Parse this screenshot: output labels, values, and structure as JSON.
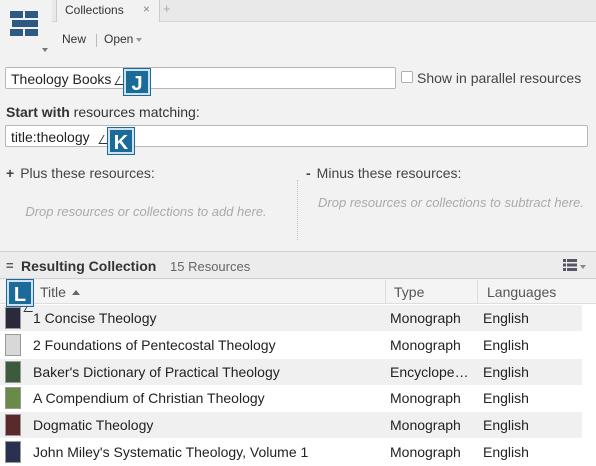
{
  "window": {
    "tab_label": "Collections",
    "tab_close": "×",
    "new_tab": "+"
  },
  "toolbar": {
    "new_label": "New",
    "open_label": "Open"
  },
  "form": {
    "name_value": "Theology Books",
    "parallel_label": "Show in parallel resources",
    "parallel_checked": false,
    "start_bold": "Start with",
    "start_rest": " resources matching:",
    "query_value": "title:theology",
    "plus_symbol": "+",
    "plus_label": "Plus these resources:",
    "plus_hint": "Drop resources or collections to add here.",
    "minus_symbol": "-",
    "minus_label": "Minus these resources:",
    "minus_hint": "Drop resources or collections to subtract here."
  },
  "badges": {
    "j": "J",
    "k": "K",
    "l": "L"
  },
  "results": {
    "eq_symbol": "=",
    "title": "Resulting Collection",
    "count": "15 Resources",
    "columns": {
      "title": "Title",
      "type": "Type",
      "languages": "Languages"
    },
    "rows": [
      {
        "title": "1 Concise Theology",
        "type": "Monograph",
        "language": "English",
        "cover_color": "#2a2a3a"
      },
      {
        "title": "2 Foundations of Pentecostal Theology",
        "type": "Monograph",
        "language": "English",
        "cover_color": "#d8d8d8"
      },
      {
        "title": "Baker's Dictionary of Practical Theology",
        "type": "Encyclope…",
        "language": "English",
        "cover_color": "#3c5a3c"
      },
      {
        "title": "A Compendium of Christian Theology",
        "type": "Monograph",
        "language": "English",
        "cover_color": "#6a8a4a"
      },
      {
        "title": "Dogmatic Theology",
        "type": "Monograph",
        "language": "English",
        "cover_color": "#5a2a2a"
      },
      {
        "title": "John Miley's Systematic Theology, Volume 1",
        "type": "Monograph",
        "language": "English",
        "cover_color": "#2a3050"
      }
    ]
  },
  "colors": {
    "badge": "#1a6a9a",
    "app_icon": "#2d5a85"
  }
}
